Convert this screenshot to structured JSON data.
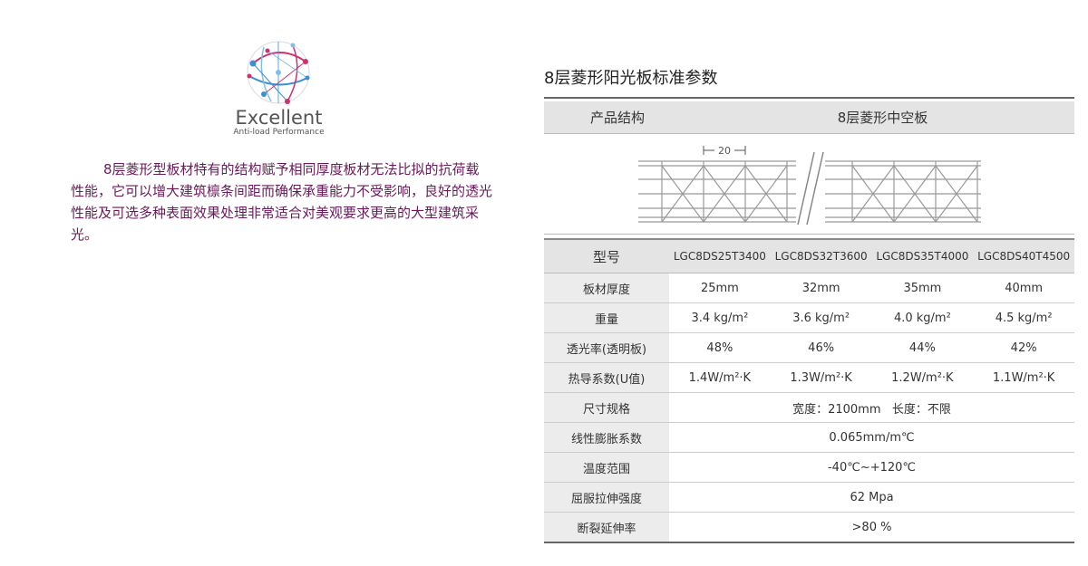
{
  "logo": {
    "title": "Excellent",
    "subtitle": "Anti-load Performance",
    "colors": {
      "pink": "#d0316e",
      "blue": "#3c8fd0",
      "light_blue": "#7ec0e8"
    }
  },
  "description": "8层菱形型板材特有的结构赋予相同厚度板材无法比拟的抗荷载性能，它可以增大建筑檩条间距而确保承重能力不受影响，良好的透光性能及可选多种表面效果处理非常适合对美观要求更高的大型建筑采光。",
  "spec": {
    "title": "8层菱形阳光板标准参数",
    "structure_label": "产品结构",
    "structure_value": "8层菱形中空板",
    "diagram_dimension": "20",
    "header": {
      "label": "型号",
      "models": [
        "LGC8DS25T3400",
        "LGC8DS32T3600",
        "LGC8DS35T4000",
        "LGC8DS40T4500"
      ]
    },
    "rows": [
      {
        "label": "板材厚度",
        "values": [
          "25mm",
          "32mm",
          "35mm",
          "40mm"
        ]
      },
      {
        "label": "重量",
        "values": [
          "3.4 kg/m²",
          "3.6 kg/m²",
          "4.0 kg/m²",
          "4.5 kg/m²"
        ]
      },
      {
        "label": "透光率(透明板)",
        "values": [
          "48%",
          "46%",
          "44%",
          "42%"
        ]
      },
      {
        "label": "热导系数(U值)",
        "values": [
          "1.4W/m²·K",
          "1.3W/m²·K",
          "1.2W/m²·K",
          "1.1W/m²·K"
        ]
      }
    ],
    "merged_rows": [
      {
        "label": "尺寸规格",
        "value": "宽度：2100mm   长度：不限"
      },
      {
        "label": "线性膨胀系数",
        "value": "0.065mm/m℃"
      },
      {
        "label": "温度范围",
        "value": "-40℃~+120℃"
      },
      {
        "label": "屈服拉伸强度",
        "value": "62 Mpa"
      },
      {
        "label": "断裂延伸率",
        "value": ">80 %"
      }
    ]
  }
}
